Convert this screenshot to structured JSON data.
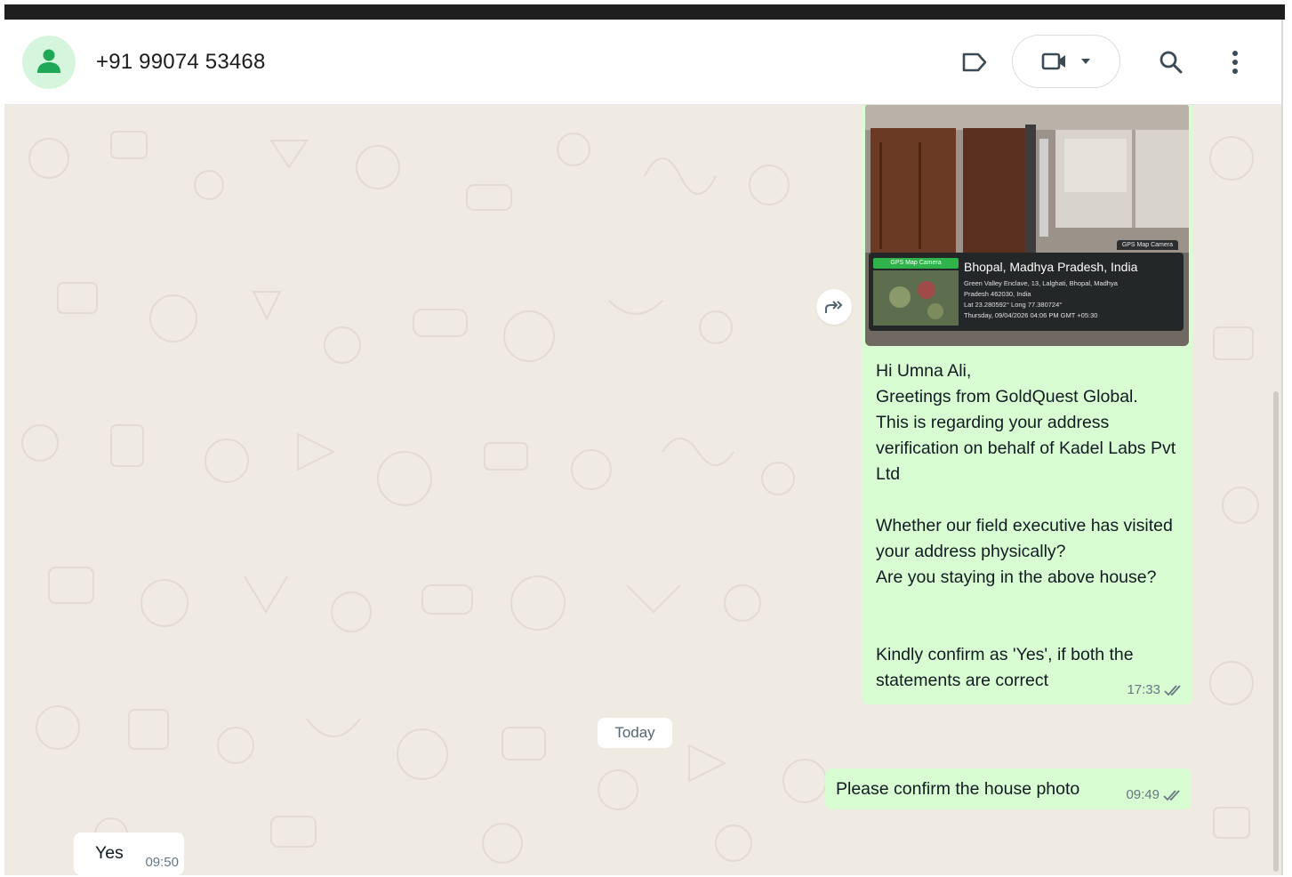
{
  "header": {
    "contact_name": "+91 99074 53468",
    "avatar_icon": "person-icon",
    "actions": [
      "label-icon",
      "video-call-icon",
      "chevron-down-icon",
      "search-icon",
      "more-vertical-icon"
    ]
  },
  "colors": {
    "accent": "#25d366",
    "outgoing_bubble": "#d9fdd3",
    "chat_background": "#efeae2",
    "avatar_background": "#d6f5dd"
  },
  "messages": [
    {
      "direction": "outgoing",
      "has_image": true,
      "image_stamp": {
        "badge": "GPS Map Camera",
        "top_label": "GPS Map Camera",
        "title": "Bhopal, Madhya Pradesh, India",
        "line1": "Green Valley Enclave, 13, Lalghati, Bhopal, Madhya",
        "line2": "Pradesh 462030, India",
        "line3": "Lat 23.280592° Long 77.380724°",
        "line4": "Thursday, 09/04/2026 04:06 PM GMT +05:30"
      },
      "text": "Hi Umna Ali,\nGreetings from GoldQuest Global.\nThis is regarding your address verification on behalf of Kadel Labs Pvt Ltd\n\nWhether our field executive has visited your address physically?\nAre you staying in the above house?\n\n\nKindly confirm as 'Yes', if both the statements are correct",
      "time": "17:33",
      "status_icon": "double-check-icon"
    },
    {
      "direction": "outgoing",
      "text": "Please confirm the house photo",
      "time": "09:49",
      "status_icon": "double-check-icon"
    },
    {
      "direction": "incoming",
      "text": "Yes",
      "time": "09:50"
    }
  ],
  "date_divider": "Today",
  "forward_icon": "forward-icon"
}
